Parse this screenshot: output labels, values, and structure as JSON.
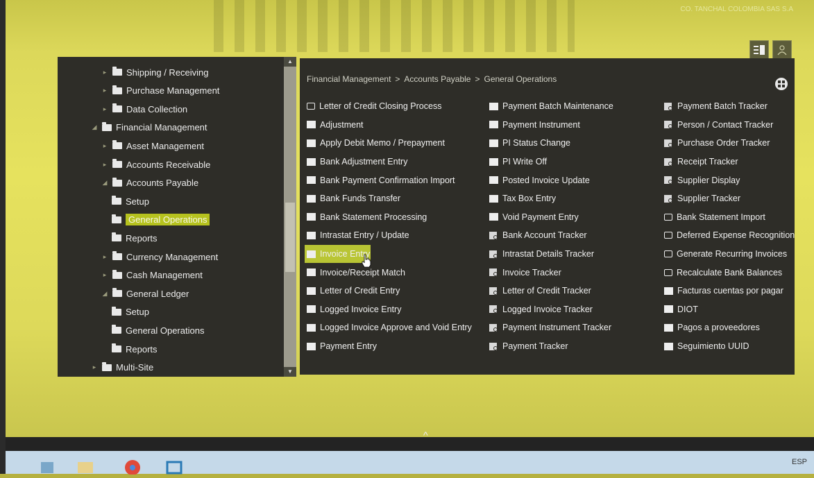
{
  "company_label": "CO. TANCHAL COLOMBIA SAS S.A",
  "tree": {
    "items": [
      {
        "label": "Shipping / Receiving",
        "level": 1,
        "expander": "collapsed"
      },
      {
        "label": "Purchase Management",
        "level": 1,
        "expander": "collapsed"
      },
      {
        "label": "Data Collection",
        "level": 1,
        "expander": "collapsed"
      },
      {
        "label": "Financial Management",
        "level": 0,
        "expander": "expanded"
      },
      {
        "label": "Asset Management",
        "level": 1,
        "expander": "collapsed"
      },
      {
        "label": "Accounts Receivable",
        "level": 1,
        "expander": "collapsed"
      },
      {
        "label": "Accounts Payable",
        "level": 1,
        "expander": "expanded"
      },
      {
        "label": "Setup",
        "level": 2,
        "expander": "none"
      },
      {
        "label": "General Operations",
        "level": 2,
        "expander": "none",
        "selected": true
      },
      {
        "label": "Reports",
        "level": 2,
        "expander": "none"
      },
      {
        "label": "Currency Management",
        "level": 1,
        "expander": "collapsed"
      },
      {
        "label": "Cash Management",
        "level": 1,
        "expander": "collapsed"
      },
      {
        "label": "General Ledger",
        "level": 1,
        "expander": "expanded"
      },
      {
        "label": "Setup",
        "level": 2,
        "expander": "none"
      },
      {
        "label": "General Operations",
        "level": 2,
        "expander": "none"
      },
      {
        "label": "Reports",
        "level": 2,
        "expander": "none"
      },
      {
        "label": "Multi-Site",
        "level": 0,
        "expander": "collapsed"
      }
    ]
  },
  "breadcrumb": {
    "part1": "Financial Management",
    "sep": ">",
    "part2": "Accounts Payable",
    "part3": "General Operations"
  },
  "columns": [
    [
      {
        "label": "Letter of Credit Closing Process",
        "icon": "link-icon"
      },
      {
        "label": "Adjustment",
        "icon": "program-icon"
      },
      {
        "label": "Apply Debit Memo / Prepayment",
        "icon": "program-icon"
      },
      {
        "label": "Bank Adjustment Entry",
        "icon": "program-icon"
      },
      {
        "label": "Bank Payment Confirmation Import",
        "icon": "program-icon"
      },
      {
        "label": "Bank Funds Transfer",
        "icon": "program-icon"
      },
      {
        "label": "Bank Statement Processing",
        "icon": "program-icon"
      },
      {
        "label": "Intrastat Entry / Update",
        "icon": "program-icon"
      },
      {
        "label": "Invoice Entry",
        "icon": "program-icon",
        "highlight": true
      },
      {
        "label": "Invoice/Receipt Match",
        "icon": "program-icon"
      },
      {
        "label": "Letter of Credit Entry",
        "icon": "program-icon"
      },
      {
        "label": "Logged Invoice Entry",
        "icon": "program-icon"
      },
      {
        "label": "Logged Invoice Approve and Void Entry",
        "icon": "program-icon"
      },
      {
        "label": "Payment Entry",
        "icon": "program-icon"
      }
    ],
    [
      {
        "label": "Payment Batch Maintenance",
        "icon": "program-icon"
      },
      {
        "label": "Payment Instrument",
        "icon": "program-icon"
      },
      {
        "label": "PI Status Change",
        "icon": "program-icon"
      },
      {
        "label": "PI Write Off",
        "icon": "program-icon"
      },
      {
        "label": "Posted Invoice Update",
        "icon": "program-icon"
      },
      {
        "label": "Tax Box Entry",
        "icon": "program-icon"
      },
      {
        "label": "Void Payment Entry",
        "icon": "program-icon"
      },
      {
        "label": "Bank Account Tracker",
        "icon": "tracker-icon"
      },
      {
        "label": "Intrastat Details Tracker",
        "icon": "tracker-icon"
      },
      {
        "label": "Invoice Tracker",
        "icon": "tracker-icon"
      },
      {
        "label": "Letter of Credit Tracker",
        "icon": "tracker-icon"
      },
      {
        "label": "Logged Invoice Tracker",
        "icon": "tracker-icon"
      },
      {
        "label": "Payment Instrument Tracker",
        "icon": "tracker-icon"
      },
      {
        "label": "Payment Tracker",
        "icon": "tracker-icon"
      }
    ],
    [
      {
        "label": "Payment Batch Tracker",
        "icon": "tracker-icon"
      },
      {
        "label": "Person / Contact Tracker",
        "icon": "tracker-icon"
      },
      {
        "label": "Purchase Order Tracker",
        "icon": "tracker-icon"
      },
      {
        "label": "Receipt Tracker",
        "icon": "tracker-icon"
      },
      {
        "label": "Supplier Display",
        "icon": "tracker-icon"
      },
      {
        "label": "Supplier Tracker",
        "icon": "tracker-icon"
      },
      {
        "label": "Bank Statement Import",
        "icon": "link-icon"
      },
      {
        "label": "Deferred Expense Recognition",
        "icon": "link-icon"
      },
      {
        "label": "Generate Recurring Invoices",
        "icon": "link-icon"
      },
      {
        "label": "Recalculate Bank Balances",
        "icon": "link-icon"
      },
      {
        "label": "Facturas cuentas por pagar",
        "icon": "program-icon"
      },
      {
        "label": "DIOT",
        "icon": "program-icon"
      },
      {
        "label": "Pagos a proveedores",
        "icon": "program-icon"
      },
      {
        "label": "Seguimiento UUID",
        "icon": "program-icon"
      }
    ]
  ],
  "taskbar": {
    "tray_text": "ESP"
  }
}
